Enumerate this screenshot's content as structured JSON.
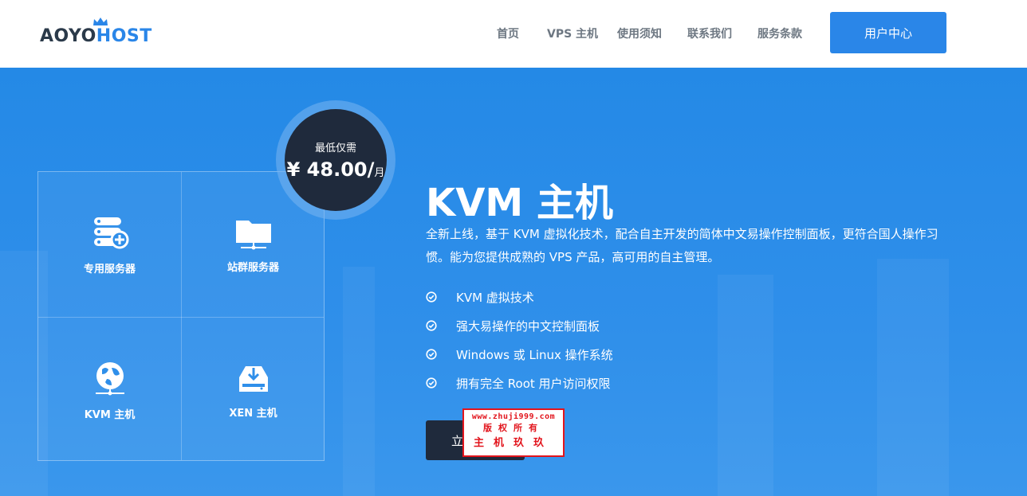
{
  "logo": {
    "part1": "AOYO",
    "part2": "HOST"
  },
  "nav": {
    "items": [
      {
        "label": "首页"
      },
      {
        "label": "VPS 主机"
      },
      {
        "label": "使用须知"
      },
      {
        "label": "联系我们"
      },
      {
        "label": "服务条款"
      }
    ],
    "user_center": "用户中心"
  },
  "hero": {
    "price": {
      "caption": "最低仅需",
      "value": "¥ 48.00/",
      "unit": "月"
    },
    "grid": [
      {
        "label": "专用服务器",
        "icon": "server-add-icon"
      },
      {
        "label": "站群服务器",
        "icon": "folder-network-icon"
      },
      {
        "label": "KVM 主机",
        "icon": "globe-network-icon"
      },
      {
        "label": "XEN 主机",
        "icon": "download-drive-icon"
      }
    ],
    "title": "KVM 主机",
    "description": "全新上线，基于 KVM 虚拟化技术，配合自主开发的简体中文易操作控制面板，更符合国人操作习惯。能为您提供成熟的 VPS 产品，高可用的自主管理。",
    "features": [
      "KVM 虚拟技术",
      "强大易操作的中文控制面板",
      "Windows 或 Linux 操作系统",
      "拥有完全 Root 用户访问权限"
    ],
    "buy_label": "立即购买"
  },
  "watermark": {
    "url": "www.zhuji999.com",
    "line2": "版权所有",
    "line3": "主机玖玖"
  },
  "colors": {
    "accent": "#2a86e8",
    "dark": "#1f2a3c",
    "watermark": "#e2141c"
  }
}
